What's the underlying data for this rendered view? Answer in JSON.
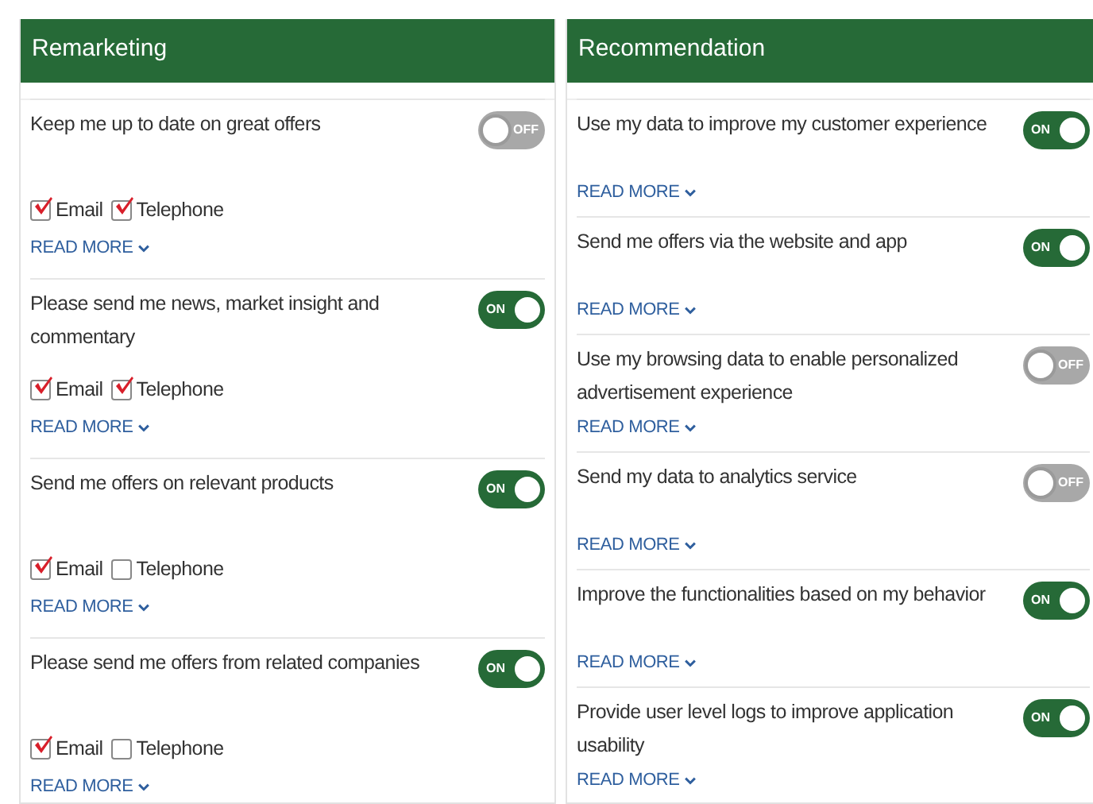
{
  "panels": [
    {
      "title": "Remarketing",
      "items": [
        {
          "text": "Keep me up to date on great offers",
          "on": false,
          "toggle_label": "OFF",
          "channels": [
            {
              "label": "Email",
              "checked": true
            },
            {
              "label": "Telephone",
              "checked": true
            }
          ],
          "link": "READ MORE"
        },
        {
          "text": "Please send me news, market insight and commentary",
          "on": true,
          "toggle_label": "ON",
          "channels": [
            {
              "label": "Email",
              "checked": true
            },
            {
              "label": "Telephone",
              "checked": true
            }
          ],
          "link": "READ MORE"
        },
        {
          "text": "Send me offers on relevant products",
          "on": true,
          "toggle_label": "ON",
          "channels": [
            {
              "label": "Email",
              "checked": true
            },
            {
              "label": "Telephone",
              "checked": false
            }
          ],
          "link": "READ MORE"
        },
        {
          "text": "Please send me offers from related companies",
          "on": true,
          "toggle_label": "ON",
          "channels": [
            {
              "label": "Email",
              "checked": true
            },
            {
              "label": "Telephone",
              "checked": false
            }
          ],
          "link": "READ MORE"
        }
      ]
    },
    {
      "title": "Recommendation",
      "items": [
        {
          "text": "Use my data to improve my customer experience",
          "on": true,
          "toggle_label": "ON",
          "link": "READ MORE"
        },
        {
          "text": "Send me offers via the website and app",
          "on": true,
          "toggle_label": "ON",
          "link": "READ MORE"
        },
        {
          "text": "Use my browsing data to enable personalized advertisement experience",
          "on": false,
          "toggle_label": "OFF",
          "link": "READ MORE"
        },
        {
          "text": "Send my data to analytics service",
          "on": false,
          "toggle_label": "OFF",
          "link": "READ MORE"
        },
        {
          "text": "Improve the functionalities based on my behavior",
          "on": true,
          "toggle_label": "ON",
          "link": "READ MORE"
        },
        {
          "text": "Provide user level logs to improve application usability",
          "on": true,
          "toggle_label": "ON",
          "link": "READ MORE"
        }
      ]
    }
  ]
}
